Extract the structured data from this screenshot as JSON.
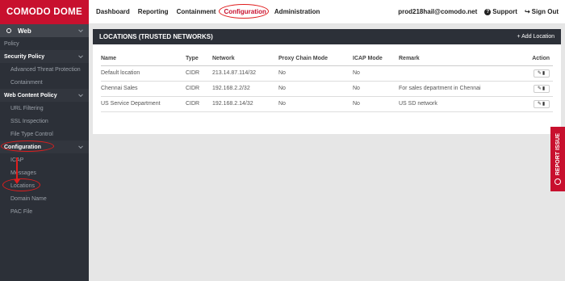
{
  "brand": {
    "name": "COMODO DOME",
    "color": "#c8102e"
  },
  "nav": {
    "items": [
      {
        "label": "Dashboard"
      },
      {
        "label": "Reporting"
      },
      {
        "label": "Containment"
      },
      {
        "label": "Configuration",
        "active": true
      },
      {
        "label": "Administration"
      }
    ]
  },
  "user": {
    "email": "prod218hail@comodo.net",
    "support": "Support",
    "signout": "Sign Out"
  },
  "sidebar": {
    "web": "Web",
    "policy": "Policy",
    "security_policy": "Security Policy",
    "advanced_threat": "Advanced Threat Protection",
    "containment": "Containment",
    "web_content_policy": "Web Content Policy",
    "url_filtering": "URL Filtering",
    "ssl_inspection": "SSL Inspection",
    "file_type_control": "File Type Control",
    "configuration": "Configuration",
    "icap": "ICAP",
    "messages": "Messages",
    "locations": "Locations",
    "domain_name": "Domain Name",
    "pac_file": "PAC File"
  },
  "panel": {
    "title": "LOCATIONS (TRUSTED NETWORKS)",
    "add_button": "+ Add Location"
  },
  "table": {
    "headers": [
      "Name",
      "Type",
      "Network",
      "Proxy Chain Mode",
      "ICAP Mode",
      "Remark",
      "Action"
    ],
    "rows": [
      [
        "Default location",
        "CIDR",
        "213.14.87.114/32",
        "No",
        "No",
        ""
      ],
      [
        "Chennai Sales",
        "CIDR",
        "192.168.2.2/32",
        "No",
        "No",
        "For sales department in Chennai"
      ],
      [
        "US Service Department",
        "CIDR",
        "192.168.2.14/32",
        "No",
        "No",
        "US SD network"
      ]
    ]
  },
  "report_issue": "REPORT ISSUE"
}
